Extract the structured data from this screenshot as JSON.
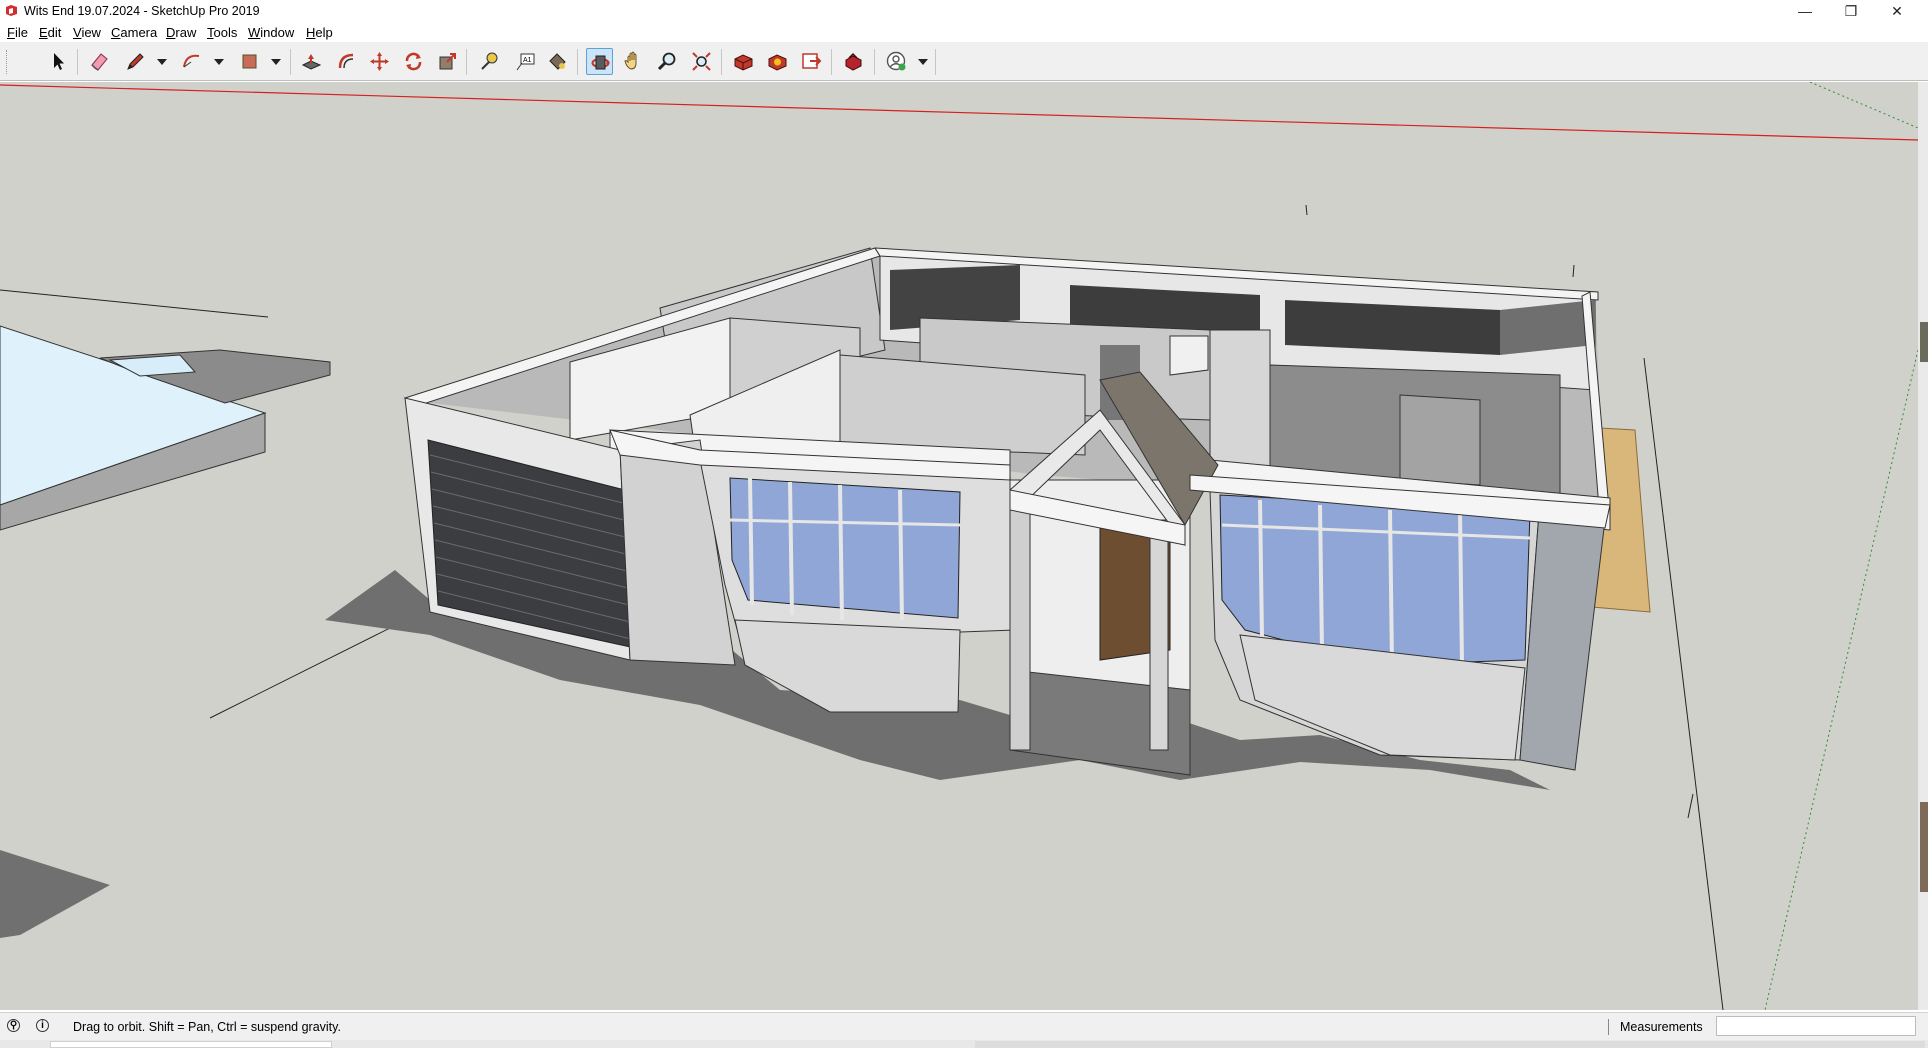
{
  "window": {
    "title": "Wits End 19.07.2024 - SketchUp Pro 2019",
    "app_icon": "sketchup-icon",
    "controls": [
      "minimize-icon",
      "restore-icon",
      "close-icon"
    ],
    "minimize": "—",
    "restore": "❐",
    "close": "✕"
  },
  "menu": {
    "items": [
      {
        "first": "F",
        "rest": "ile"
      },
      {
        "first": "E",
        "rest": "dit"
      },
      {
        "first": "V",
        "rest": "iew"
      },
      {
        "first": "C",
        "rest": "amera"
      },
      {
        "first": "D",
        "rest": "raw"
      },
      {
        "first": "T",
        "rest": "ools"
      },
      {
        "first": "W",
        "rest": "indow"
      },
      {
        "first": "H",
        "rest": "elp"
      }
    ]
  },
  "toolbar": {
    "tools": [
      "select-icon",
      "eraser-icon",
      "line-icon",
      "arc-icon",
      "rectangle-icon",
      "push-pull-icon",
      "offset-icon",
      "move-icon",
      "rotate-icon",
      "scale-icon",
      "tape-measure-icon",
      "text-icon",
      "paint-bucket-icon",
      "orbit-icon",
      "pan-icon",
      "zoom-icon",
      "zoom-extents-icon",
      "3d-warehouse-icon",
      "extension-warehouse-icon",
      "layout-icon",
      "extension-manager-icon",
      "account-icon"
    ],
    "active_tool": "orbit-icon",
    "active_color": "#cce4f7"
  },
  "viewport": {
    "background": "#d1d1cc",
    "axis_red": "#d42020",
    "axis_green": "#2f8f2f",
    "glass": "#8fa6d6",
    "garage_door": "#3c3d40",
    "roof_tile": "#7c756b",
    "deck": "#d9b77a"
  },
  "status": {
    "message": "Drag to orbit. Shift = Pan, Ctrl = suspend gravity.",
    "measurements_label": "Measurements",
    "measurements_value": "",
    "geo_icon": "geolocation-icon",
    "info_icon": "info-icon"
  }
}
